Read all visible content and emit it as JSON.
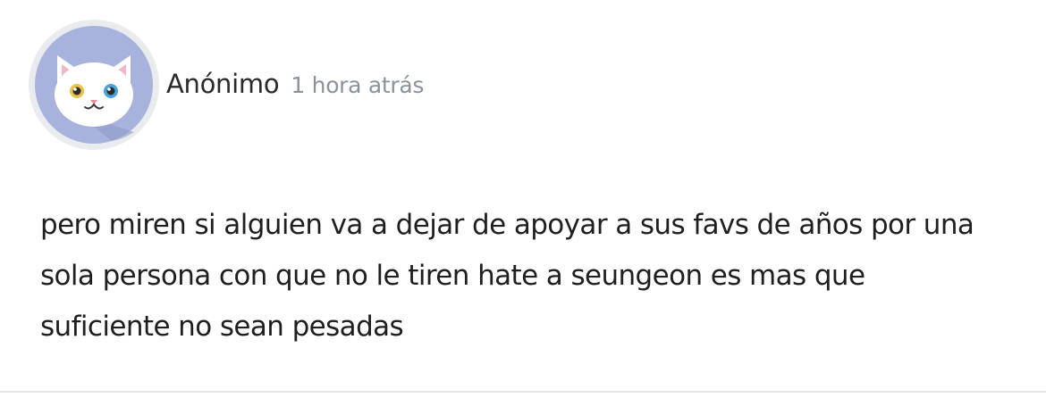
{
  "post": {
    "author": "Anónimo",
    "timestamp": "1 hora atrás",
    "lines": [
      "pero miren si alguien va a dejar de apoyar a sus favs de años por una",
      "sola persona con que no le tiren hate a seungeon es mas que",
      "suficiente no sean pesadas"
    ],
    "avatar_icon": "white-cat-avatar-icon"
  },
  "colors": {
    "avatar_ring": "#e9ebee",
    "avatar_background": "#a7b3dc",
    "avatar_shadow": "#8f9bc8",
    "timestamp_text": "#8a929b",
    "divider": "#e6e6e6"
  }
}
